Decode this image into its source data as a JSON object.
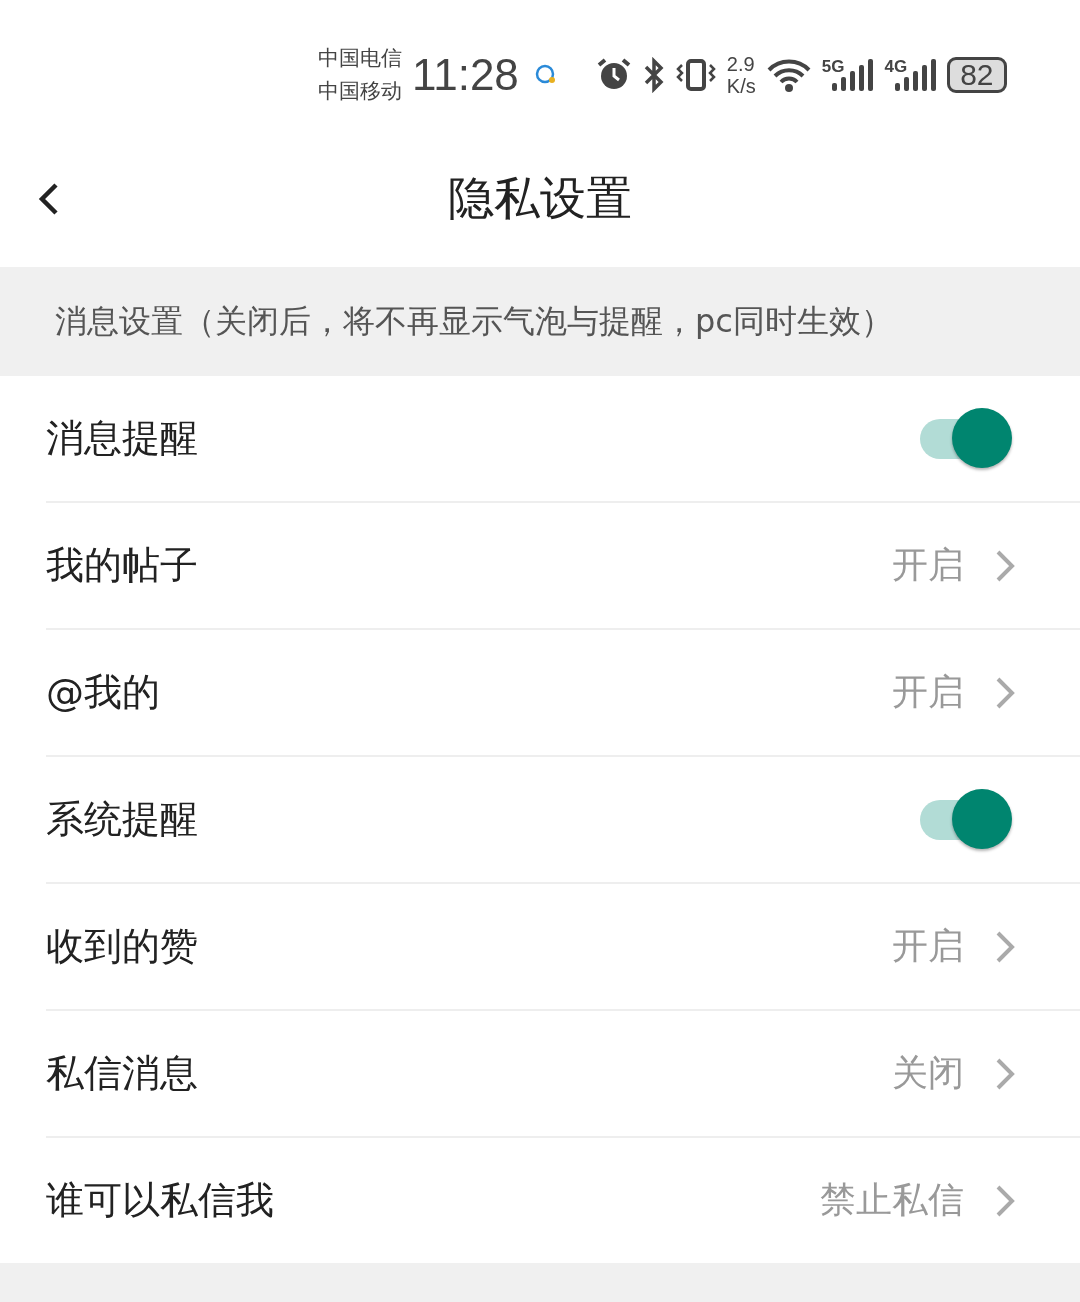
{
  "status_bar": {
    "carriers": [
      "中国电信",
      "中国移动"
    ],
    "time": "11:28",
    "speed_value": "2.9",
    "speed_unit": "K/s",
    "signals": [
      {
        "label": "5G"
      },
      {
        "label": "4G"
      }
    ],
    "battery": "82"
  },
  "nav": {
    "title": "隐私设置"
  },
  "section": {
    "title": "消息设置（关闭后，将不再显示气泡与提醒，pc同时生效）"
  },
  "rows": [
    {
      "kind": "toggle",
      "label": "消息提醒",
      "on": true
    },
    {
      "kind": "link",
      "label": "我的帖子",
      "value": "开启"
    },
    {
      "kind": "link",
      "label": "@我的",
      "value": "开启"
    },
    {
      "kind": "toggle",
      "label": "系统提醒",
      "on": true
    },
    {
      "kind": "link",
      "label": "收到的赞",
      "value": "开启"
    },
    {
      "kind": "link",
      "label": "私信消息",
      "value": "关闭"
    },
    {
      "kind": "link",
      "label": "谁可以私信我",
      "value": "禁止私信"
    }
  ]
}
